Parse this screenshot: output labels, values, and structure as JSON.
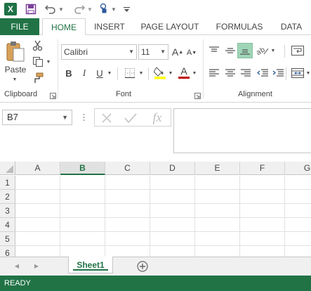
{
  "qat": {
    "app_icon": "excel-logo-icon",
    "logo_letter": "X",
    "save_icon": "save-icon",
    "undo_icon": "undo-icon",
    "redo_icon": "redo-icon",
    "touch_icon": "touch-mode-icon",
    "customize_icon": "customize-qat-icon"
  },
  "tabs": [
    "FILE",
    "HOME",
    "INSERT",
    "PAGE LAYOUT",
    "FORMULAS",
    "DATA"
  ],
  "ribbon": {
    "clipboard": {
      "label": "Clipboard",
      "paste_label": "Paste",
      "icons": [
        "paste-icon",
        "cut-icon",
        "copy-icon",
        "format-painter-icon"
      ]
    },
    "font": {
      "label": "Font",
      "font_name": "Calibri",
      "font_size": "11",
      "grow_label": "A",
      "shrink_label": "A",
      "bold": "B",
      "italic": "I",
      "underline": "U",
      "font_color_label": "A",
      "icons": [
        "border-icon",
        "fill-color-icon",
        "font-color-icon"
      ]
    },
    "alignment": {
      "label": "Alignment",
      "icons": [
        "align-top-icon",
        "align-middle-icon",
        "align-bottom-icon",
        "orientation-icon",
        "wrap-text-icon",
        "align-left-icon",
        "align-center-icon",
        "align-right-icon",
        "decrease-indent-icon",
        "increase-indent-icon",
        "merge-center-icon"
      ]
    }
  },
  "formula_bar": {
    "name_box": "B7",
    "fx_label": "fx",
    "formula_value": ""
  },
  "grid": {
    "columns": [
      "A",
      "B",
      "C",
      "D",
      "E",
      "F",
      "G"
    ],
    "selected_column": "B",
    "rows": [
      "1",
      "2",
      "3",
      "4",
      "5",
      "6"
    ]
  },
  "sheets": {
    "tabs": [
      "Sheet1"
    ],
    "active": "Sheet1"
  },
  "status": {
    "text": "READY"
  },
  "colors": {
    "accent": "#217346",
    "status_bar": "#217346",
    "font_color_bar": "#c00000",
    "fill_color_bar": "#ffff00"
  }
}
